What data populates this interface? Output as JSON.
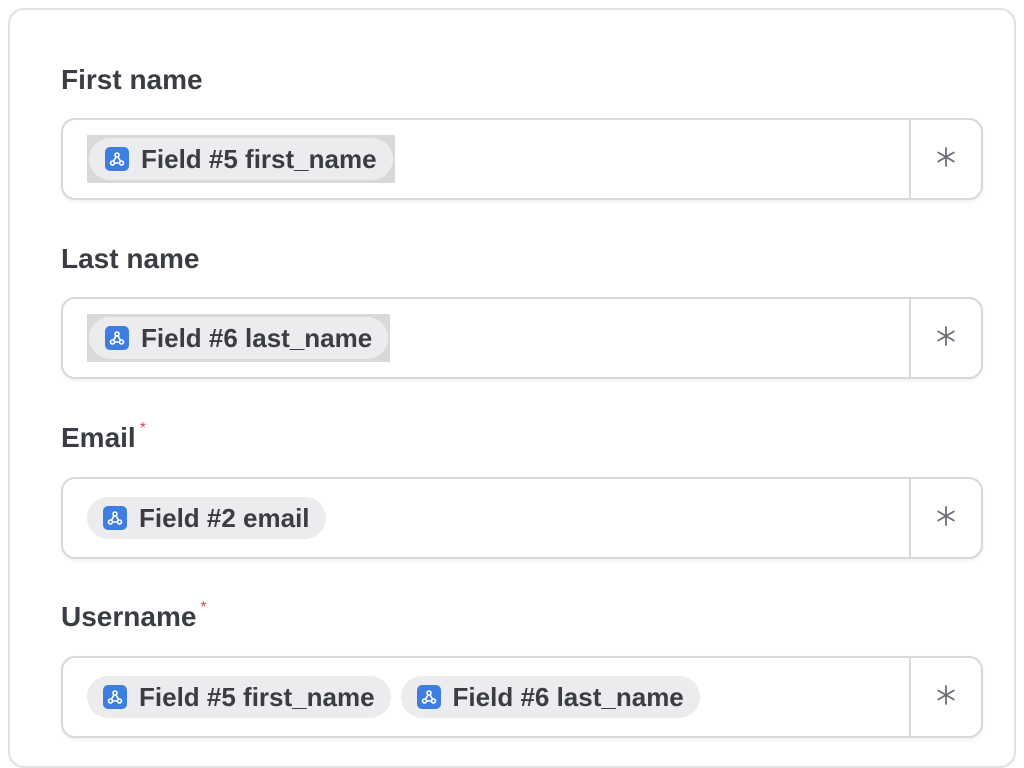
{
  "fields": [
    {
      "label": "First name",
      "required": false,
      "required_mark": "",
      "tokens": [
        {
          "text": "Field #5 first_name",
          "icon": "webhook-icon"
        }
      ],
      "action_icon": "asterisk-icon"
    },
    {
      "label": "Last name",
      "required": false,
      "required_mark": "",
      "tokens": [
        {
          "text": "Field #6 last_name",
          "icon": "webhook-icon"
        }
      ],
      "action_icon": "asterisk-icon"
    },
    {
      "label": "Email",
      "required": true,
      "required_mark": "*",
      "tokens": [
        {
          "text": "Field #2 email",
          "icon": "webhook-icon"
        }
      ],
      "action_icon": "asterisk-icon"
    },
    {
      "label": "Username",
      "required": true,
      "required_mark": "*",
      "tokens": [
        {
          "text": "Field #5 first_name",
          "icon": "webhook-icon"
        },
        {
          "text": "Field #6 last_name",
          "icon": "webhook-icon"
        }
      ],
      "action_icon": "asterisk-icon"
    }
  ],
  "colors": {
    "token_icon_bg": "#3d7ee0",
    "required": "#e5484d",
    "token_bg": "#ececee",
    "text": "#3a3d43"
  }
}
